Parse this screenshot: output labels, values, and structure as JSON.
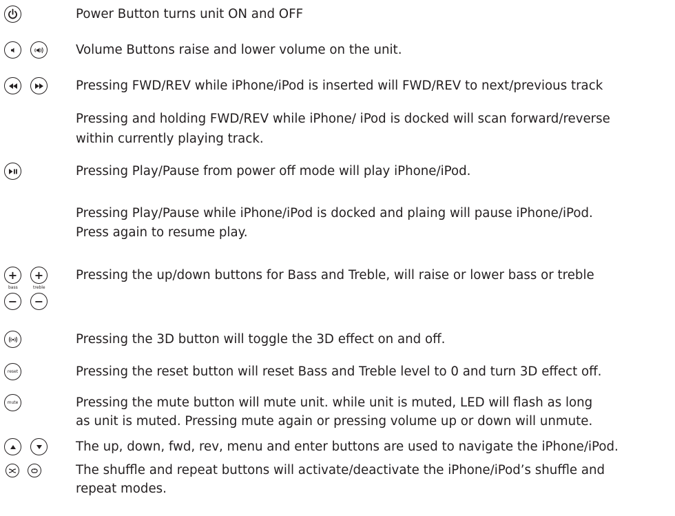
{
  "items": [
    {
      "text": "Power Button turns unit ON and OFF"
    },
    {
      "text": "Volume Buttons raise and lower volume on the unit."
    },
    {
      "text": "Pressing FWD/REV while iPhone/iPod is inserted will FWD/REV to next/previous track"
    },
    {
      "text": "Pressing and holding FWD/REV while iPhone/ iPod is docked will scan forward/reverse",
      "text2": "within currently playing track."
    },
    {
      "text": "Pressing Play/Pause from power off mode will play iPhone/iPod."
    },
    {
      "text": "Pressing Play/Pause while iPhone/iPod is docked and plaing will pause iPhone/iPod.",
      "text2": "Press again to resume play."
    },
    {
      "text": "Pressing the up/down buttons for Bass and Treble, will raise or lower bass or treble"
    },
    {
      "text": "Pressing the 3D button will toggle the 3D effect on  and off."
    },
    {
      "text": "Pressing the reset button will reset Bass and Treble level to 0 and turn 3D effect off."
    },
    {
      "text": "Pressing the mute button will mute unit. while unit is muted, LED will flash as long",
      "text2": "as unit is muted. Pressing mute again or pressing volume up or down will unmute."
    },
    {
      "text": "The up, down, fwd, rev, menu and enter buttons are used to navigate the iPhone/iPod."
    },
    {
      "text": "The shuffle and repeat buttons will activate/deactivate the iPhone/iPod’s shuffle and",
      "text2": "repeat modes."
    }
  ],
  "labels": {
    "bass": "bass",
    "treble": "treble",
    "reset": "reset",
    "mute": "mute"
  },
  "icons": [
    "power-icon",
    "volume-down-icon",
    "volume-up-icon",
    "rewind-icon",
    "fast-forward-icon",
    "play-pause-icon",
    "bass-up-icon",
    "treble-up-icon",
    "bass-down-icon",
    "treble-down-icon",
    "3d-icon",
    "reset-icon",
    "mute-icon",
    "up-icon",
    "down-icon",
    "shuffle-icon",
    "repeat-icon"
  ]
}
